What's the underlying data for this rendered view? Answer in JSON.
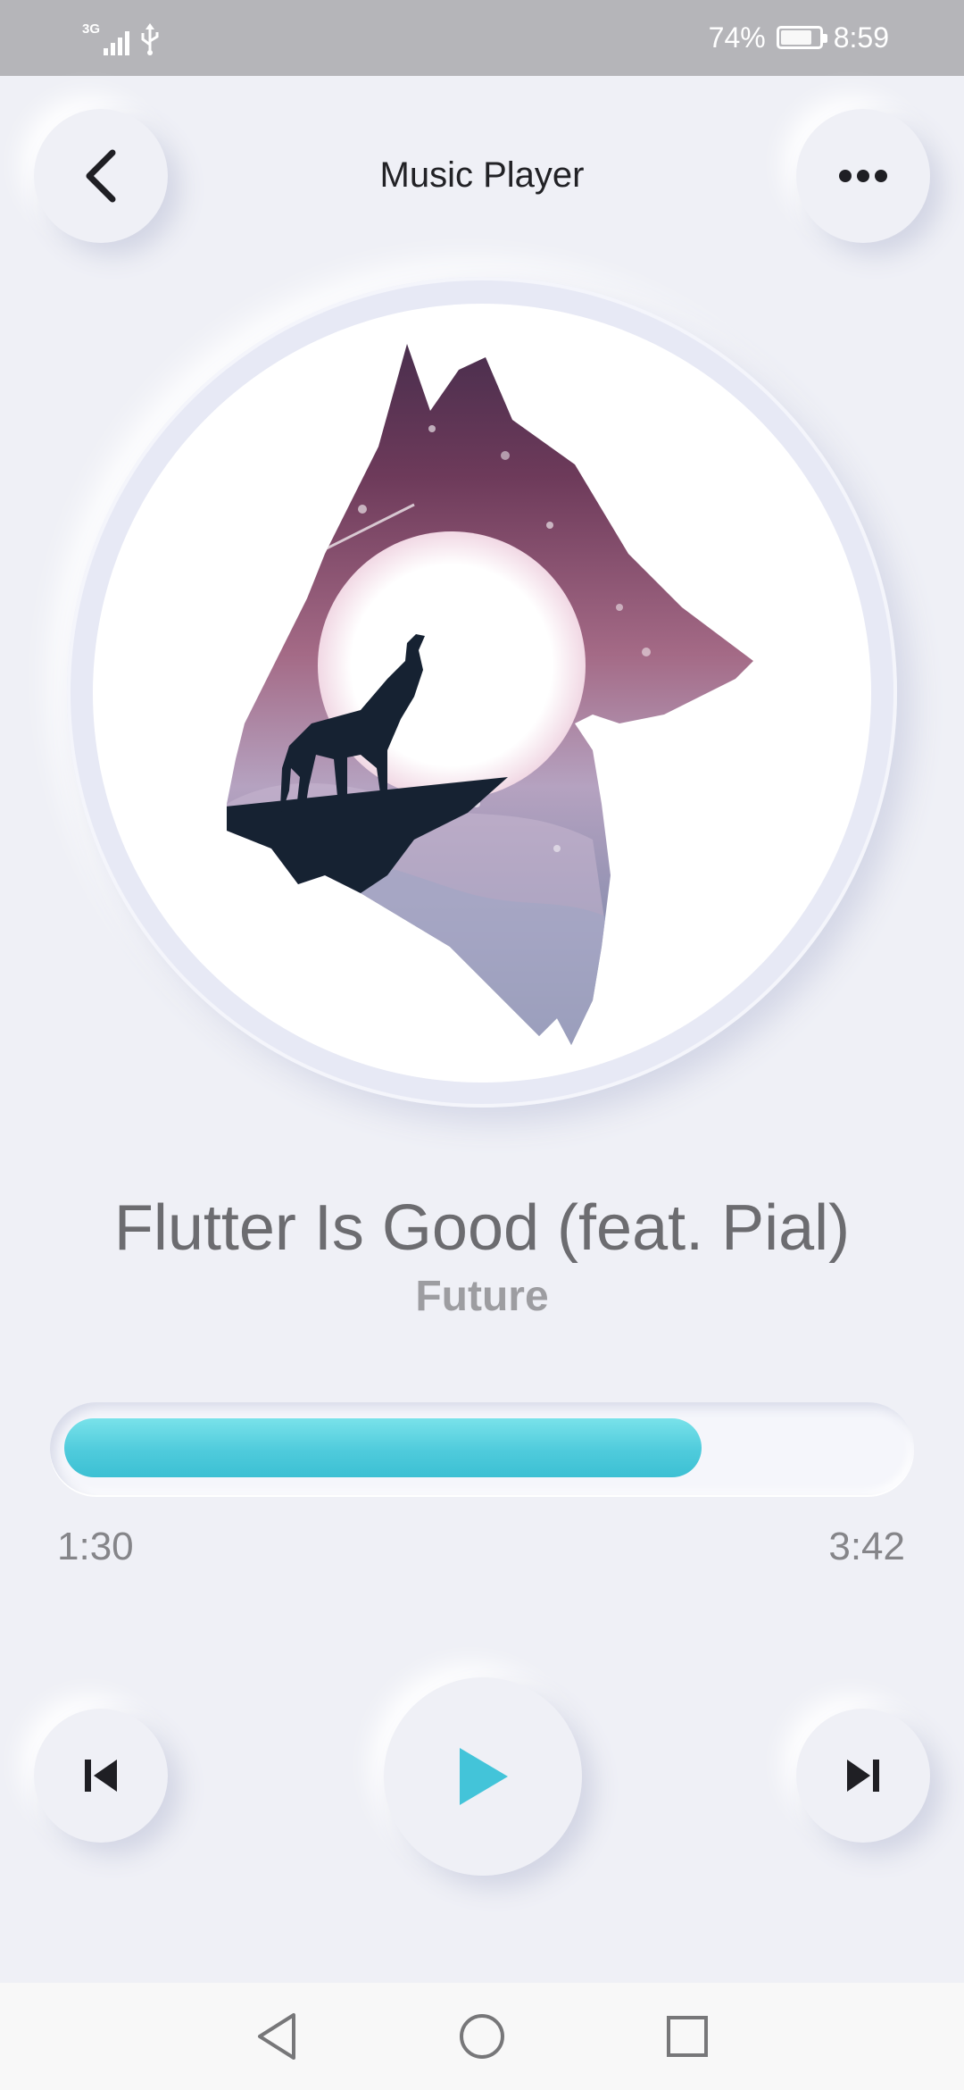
{
  "status_bar": {
    "network_type": "3G",
    "battery_percent_label": "74%",
    "battery_level": 0.74,
    "time": "8:59",
    "icons": [
      "signal-icon",
      "usb-icon",
      "battery-icon"
    ]
  },
  "header": {
    "title": "Music Player",
    "back_icon": "chevron-left-icon",
    "more_icon": "more-horizontal-icon"
  },
  "track": {
    "title": "Flutter Is Good (feat. Pial)",
    "artist": "Future",
    "artwork": "wolf-howling-moon-artwork"
  },
  "progress": {
    "elapsed": "1:30",
    "total": "3:42",
    "fraction": 0.763,
    "accent_color": "#4fcbdc"
  },
  "controls": {
    "previous_icon": "skip-previous-icon",
    "play_icon": "play-icon",
    "next_icon": "skip-next-icon",
    "play_color": "#43c4d9"
  },
  "system_nav": {
    "icons": [
      "nav-back-icon",
      "nav-home-icon",
      "nav-recents-icon"
    ]
  }
}
